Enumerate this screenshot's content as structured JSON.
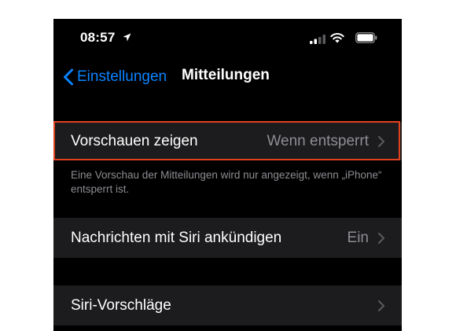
{
  "status_bar": {
    "time": "08:57",
    "icons": [
      "location-arrow-icon",
      "cellular-signal-icon",
      "wifi-icon",
      "battery-icon"
    ]
  },
  "nav": {
    "back_label": "Einstellungen",
    "title": "Mitteilungen"
  },
  "settings": {
    "previews": {
      "label": "Vorschauen zeigen",
      "value": "Wenn entsperrt"
    },
    "previews_footer": "Eine Vorschau der Mitteilungen wird nur angezeigt, wenn „iPhone“ entsperrt ist.",
    "announce": {
      "label": "Nachrichten mit Siri ankündigen",
      "value": "Ein"
    },
    "suggestions": {
      "label": "Siri-Vorschläge"
    }
  },
  "colors": {
    "accent": "#0a84ff",
    "cell_background": "#1c1c1e",
    "secondary_text": "#8d8d93",
    "highlight_border": "#e0421f"
  }
}
